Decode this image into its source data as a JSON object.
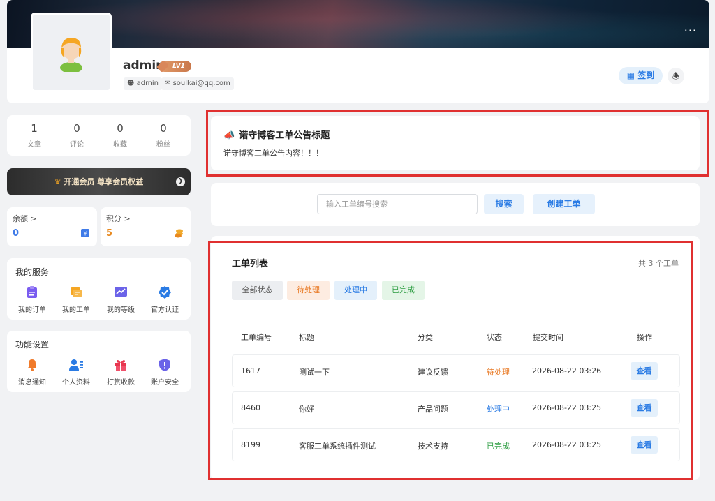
{
  "profile": {
    "username": "admin",
    "level_badge": "LV1",
    "tag_user": "admin",
    "tag_email": "soulkai@qq.com",
    "more_menu": "···",
    "checkin_label": "签到"
  },
  "stats": [
    {
      "value": "1",
      "label": "文章"
    },
    {
      "value": "0",
      "label": "评论"
    },
    {
      "value": "0",
      "label": "收藏"
    },
    {
      "value": "0",
      "label": "粉丝"
    }
  ],
  "vip": {
    "label": "开通会员 尊享会员权益"
  },
  "balance": {
    "title": "余额 >",
    "value": "0",
    "color": "#3f7be8"
  },
  "points": {
    "title": "积分 >",
    "value": "5",
    "color": "#e8891f"
  },
  "services": {
    "title": "我的服务",
    "items": [
      {
        "label": "我的订单",
        "icon": "order-icon"
      },
      {
        "label": "我的工单",
        "icon": "ticket-icon"
      },
      {
        "label": "我的等级",
        "icon": "level-icon"
      },
      {
        "label": "官方认证",
        "icon": "verified-icon"
      }
    ]
  },
  "settings": {
    "title": "功能设置",
    "items": [
      {
        "label": "消息通知",
        "icon": "bell-icon"
      },
      {
        "label": "个人资料",
        "icon": "profile-icon"
      },
      {
        "label": "打赏收款",
        "icon": "gift-icon"
      },
      {
        "label": "账户安全",
        "icon": "shield-icon"
      }
    ]
  },
  "announcement": {
    "title": "诺守博客工单公告标题",
    "content": "诺守博客工单公告内容！！！"
  },
  "search": {
    "placeholder": "输入工单编号搜索",
    "search_label": "搜索",
    "create_label": "创建工单"
  },
  "ticket_list": {
    "title": "工单列表",
    "count_text": "共 3 个工单",
    "filters": [
      "全部状态",
      "待处理",
      "处理中",
      "已完成"
    ],
    "columns": [
      "工单编号",
      "标题",
      "分类",
      "状态",
      "提交时间",
      "操作"
    ],
    "rows": [
      {
        "id": "1617",
        "title": "测试一下",
        "category": "建议反馈",
        "status": "待处理",
        "time": "2026-08-22 03:26",
        "action": "查看"
      },
      {
        "id": "8460",
        "title": "你好",
        "category": "产品问题",
        "status": "处理中",
        "time": "2026-08-22 03:25",
        "action": "查看"
      },
      {
        "id": "8199",
        "title": "客服工单系统插件测试",
        "category": "技术支持",
        "status": "已完成",
        "time": "2026-08-22 03:25",
        "action": "查看"
      }
    ]
  }
}
